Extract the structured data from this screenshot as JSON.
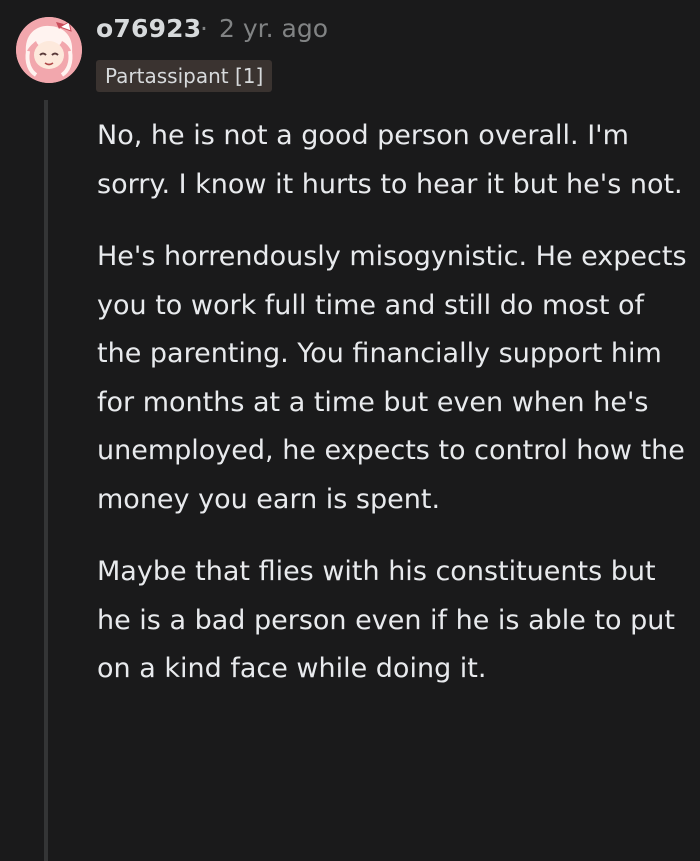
{
  "comment": {
    "username": "o76923",
    "separator": "·",
    "timestamp": "2 yr. ago",
    "flair": "Partassipant [1]",
    "paragraphs": [
      "No, he is not a good person overall. I'm sorry. I know it hurts to hear it but he's not.",
      "He's horrendously misogynistic. He expects you to work full time and still do most of the parenting. You financially support him for months at a time but even when he's unemployed, he expects to control how the money you earn is spent.",
      "Maybe that flies with his constituents but he is a bad person even if he is able to put on a kind face while doing it."
    ]
  },
  "colors": {
    "background": "#1a1a1b",
    "text": "#d7dadc",
    "meta_text": "#818384",
    "flair_background": "#3a3330",
    "thread_line": "#343536",
    "avatar_background": "#f2a7ad"
  }
}
